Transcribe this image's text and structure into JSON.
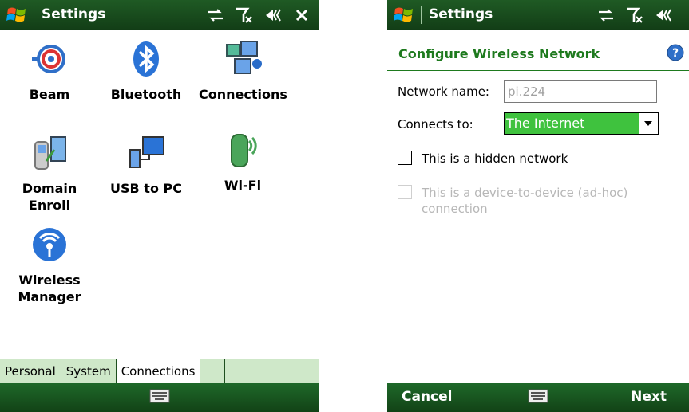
{
  "left_screen": {
    "title": "Settings",
    "apps": [
      {
        "label": "Beam",
        "icon": "beam-icon"
      },
      {
        "label": "Bluetooth",
        "icon": "bluetooth-icon"
      },
      {
        "label": "Connections",
        "icon": "connections-icon"
      },
      {
        "label": "Domain Enroll",
        "icon": "domain-enroll-icon"
      },
      {
        "label": "USB to PC",
        "icon": "usb-to-pc-icon"
      },
      {
        "label": "Wi-Fi",
        "icon": "wifi-icon",
        "selected": true
      },
      {
        "label": "Wireless Manager",
        "icon": "wireless-manager-icon"
      }
    ],
    "tabs": [
      "Personal",
      "System",
      "Connections"
    ],
    "active_tab": "Connections",
    "status_icons": [
      "sync-icon",
      "no-signal-icon",
      "speaker-icon",
      "close-icon"
    ]
  },
  "right_screen": {
    "title": "Settings",
    "form_title": "Configure Wireless Network",
    "network_name_label": "Network name:",
    "network_name_value": "pi.224",
    "connects_to_label": "Connects to:",
    "connects_to_value": "The Internet",
    "hidden_network_label": "This is a hidden network",
    "hidden_network_checked": false,
    "adhoc_label": "This is a device-to-device (ad-hoc) connection",
    "adhoc_enabled": false,
    "soft_left": "Cancel",
    "soft_right": "Next",
    "status_icons": [
      "sync-icon",
      "no-signal-icon",
      "speaker-icon"
    ]
  },
  "colors": {
    "titlebar": "#1a4d1e",
    "accent_green": "#1e7a1e",
    "selection_green": "#3fc23e",
    "tab_bg": "#cfe8c9"
  }
}
